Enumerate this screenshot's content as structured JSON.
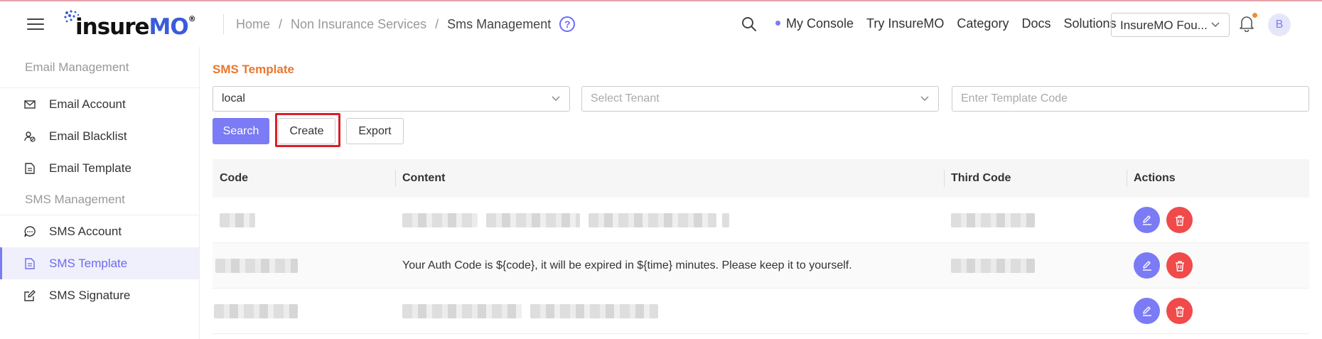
{
  "header": {
    "logo": "insureMO",
    "breadcrumb": [
      "Home",
      "Non Insurance Services",
      "Sms Management"
    ],
    "nav": [
      "My Console",
      "Try InsureMO",
      "Category",
      "Docs",
      "Solutions"
    ],
    "tenant_select": "InsureMO Fou...",
    "avatar_letter": "B",
    "help_symbol": "?"
  },
  "sidebar": {
    "groups": [
      {
        "label": "Email Management",
        "items": [
          {
            "label": "Email Account",
            "icon": "mail-icon"
          },
          {
            "label": "Email Blacklist",
            "icon": "user-block-icon"
          },
          {
            "label": "Email Template",
            "icon": "document-icon"
          }
        ]
      },
      {
        "label": "SMS Management",
        "items": [
          {
            "label": "SMS Account",
            "icon": "chat-icon"
          },
          {
            "label": "SMS Template",
            "icon": "document-icon",
            "active": true
          },
          {
            "label": "SMS Signature",
            "icon": "edit-icon"
          }
        ]
      }
    ]
  },
  "main": {
    "section_title": "SMS Template",
    "filters": {
      "environment_value": "local",
      "tenant_placeholder": "Select Tenant",
      "template_code_placeholder": "Enter Template Code"
    },
    "buttons": {
      "search": "Search",
      "create": "Create",
      "export": "Export"
    },
    "table": {
      "columns": [
        "Code",
        "Content",
        "Third Code",
        "Actions"
      ],
      "rows": [
        {
          "content": ""
        },
        {
          "content": "Your Auth Code is ${code}, it will be expired in ${time} minutes. Please keep it to yourself."
        },
        {
          "content": ""
        }
      ]
    }
  },
  "colors": {
    "accent": "#7b7bf5",
    "title_orange": "#e8772e",
    "delete_red": "#f04a4a",
    "highlight_red": "#d8202a"
  }
}
